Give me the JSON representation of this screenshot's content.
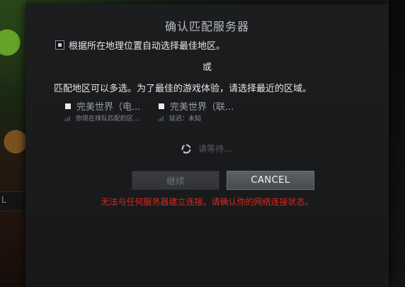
{
  "dialog": {
    "title": "确认匹配服务器",
    "auto_select_label": "根据所在地理位置自动选择最佳地区。",
    "or_text": "或",
    "multi_select_text": "匹配地区可以多选。为了最佳的游戏体验，请选择最近的区域。",
    "regions": [
      {
        "name": "完美世界（电...",
        "note": "你现在排队匹配的区..."
      },
      {
        "name": "完美世界（联...",
        "note": "延迟：未知"
      }
    ],
    "waiting_text": "请等待...",
    "continue_label": "继续",
    "cancel_label": "CANCEL",
    "error_text": "无法与任何服务器建立连接。请确认你的网络连接状态。"
  },
  "background": {
    "side_label": "L"
  },
  "colors": {
    "error": "#d62a1c",
    "text": "#e6e8ea",
    "title": "#b8bcc0",
    "cancel_bg": "#4f5459"
  },
  "icons": {
    "spinner": "refresh-spinner-icon",
    "signal": "signal-bars-icon"
  }
}
